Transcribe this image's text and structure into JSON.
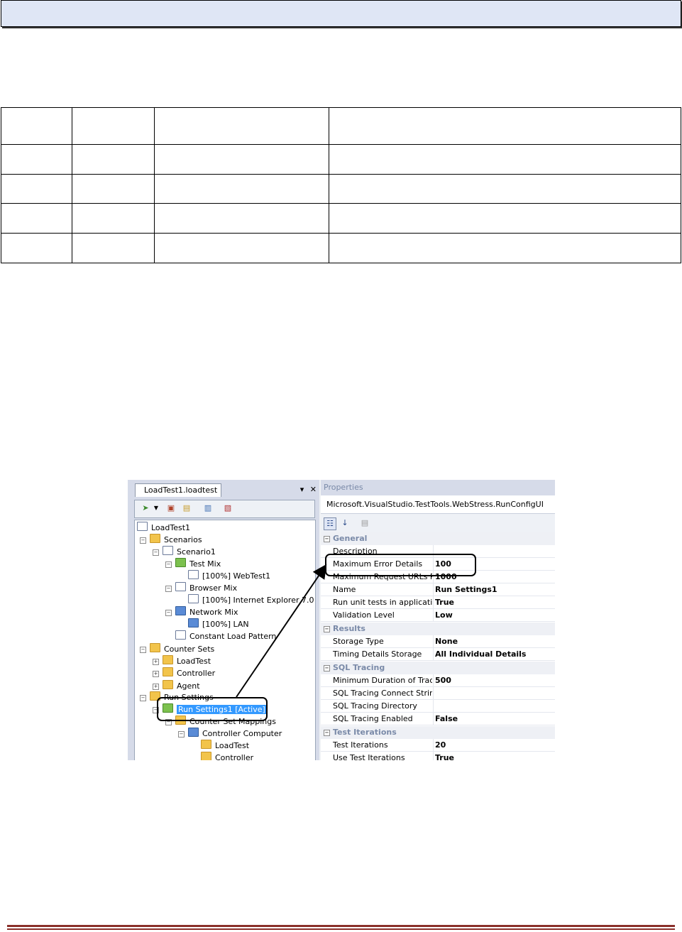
{
  "screenshot": {
    "tab_label": "LoadTest1.loadtest",
    "pane_controls": {
      "menu_icon": "▾",
      "close_icon": "✕"
    },
    "tree": [
      "LoadTest1",
      "Scenarios",
      "Scenario1",
      "Test Mix",
      "[100%] WebTest1",
      "Browser Mix",
      "[100%] Internet Explorer 7.0",
      "Network Mix",
      "[100%] LAN",
      "Constant Load Pattern",
      "Counter Sets",
      "LoadTest",
      "Controller",
      "Agent",
      "Run Settings",
      "Run Settings1 [Active]",
      "Counter Set Mappings",
      "Controller Computer",
      "LoadTest",
      "Controller"
    ],
    "properties": {
      "title": "Properties",
      "object_type": "Microsoft.VisualStudio.TestTools.WebStress.RunConfigUI",
      "categories": [
        {
          "name": "General",
          "rows": [
            {
              "name": "Description",
              "value": ""
            },
            {
              "name": "Maximum Error Details",
              "value": "100"
            },
            {
              "name": "Maximum Request URLs Re",
              "value": "1000"
            },
            {
              "name": "Name",
              "value": "Run Settings1"
            },
            {
              "name": "Run unit tests in application",
              "value": "True"
            },
            {
              "name": "Validation Level",
              "value": "Low"
            }
          ]
        },
        {
          "name": "Results",
          "rows": [
            {
              "name": "Storage Type",
              "value": "None"
            },
            {
              "name": "Timing Details Storage",
              "value": "All Individual Details"
            }
          ]
        },
        {
          "name": "SQL Tracing",
          "rows": [
            {
              "name": "Minimum Duration of Trace",
              "value": "500"
            },
            {
              "name": "SQL Tracing Connect String",
              "value": ""
            },
            {
              "name": "SQL Tracing Directory",
              "value": ""
            },
            {
              "name": "SQL Tracing Enabled",
              "value": "False"
            }
          ]
        },
        {
          "name": "Test Iterations",
          "rows": [
            {
              "name": "Test Iterations",
              "value": "20"
            },
            {
              "name": "Use Test Iterations",
              "value": "True"
            }
          ]
        }
      ]
    }
  }
}
